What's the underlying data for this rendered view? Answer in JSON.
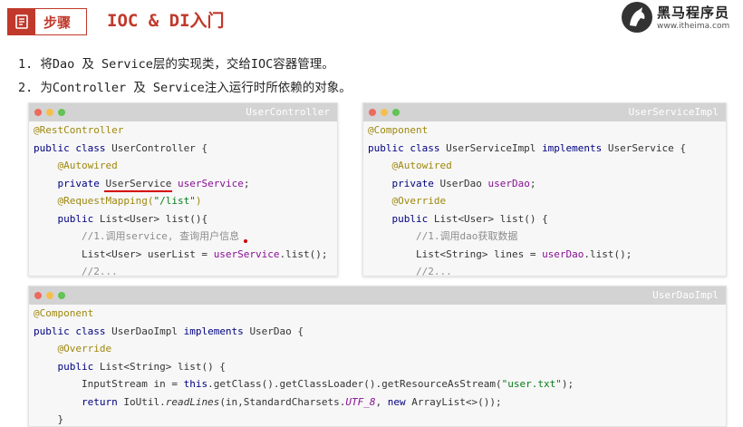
{
  "header": {
    "badge_label": "步骤",
    "title": "IOC & DI入门"
  },
  "logo": {
    "name": "黑马程序员",
    "url": "www.itheima.com"
  },
  "steps": [
    "1. 将Dao 及 Service层的实现类，交给IOC容器管理。",
    "2. 为Controller 及 Service注入运行时所依赖的对象。"
  ],
  "windows": {
    "user_controller": {
      "title": "UserController",
      "l1": "@RestController",
      "l2_kw": "public class ",
      "l2_rest": "UserController {",
      "l3": "@Autowired",
      "l4_kw": "private ",
      "l4_type": "UserService",
      "l4_field": "userService",
      "l4_end": ";",
      "l5_ann": "@RequestMapping(",
      "l5_str": "\"/list\"",
      "l5_end": ")",
      "l6_kw": "public ",
      "l6_rest": "List<User> list(){",
      "l7": "//1.调用service, 查询用户信息",
      "l8_a": "List<User> userList = ",
      "l8_field": "userService",
      "l8_end": ".list();",
      "l9": "//2..."
    },
    "user_service_impl": {
      "title": "UserServiceImpl",
      "l1": "@Component",
      "l2_kw": "public class ",
      "l2_name": "UserServiceImpl ",
      "l2_kw2": "implements ",
      "l2_rest": "UserService {",
      "l3": "@Autowired",
      "l4_kw": "private ",
      "l4_type": "UserDao ",
      "l4_field": "userDao",
      "l4_end": ";",
      "l5": "@Override",
      "l6_kw": "public ",
      "l6_rest": "List<User> list() {",
      "l7": "//1.调用dao获取数据",
      "l8_a": "List<String> lines = ",
      "l8_field": "userDao",
      "l8_end": ".list();",
      "l9": "//2..."
    },
    "user_dao_impl": {
      "title": "UserDaoImpl",
      "l1": "@Component",
      "l2_kw": "public class ",
      "l2_name": "UserDaoImpl ",
      "l2_kw2": "implements ",
      "l2_rest": "UserDao {",
      "l3": "@Override",
      "l4_kw": "public ",
      "l4_rest": "List<String> list() {",
      "l5_a": "InputStream in = ",
      "l5_kw": "this",
      "l5_b": ".getClass().getClassLoader().getResourceAsStream(",
      "l5_str": "\"user.txt\"",
      "l5_end": ");",
      "l6_kw": "return ",
      "l6_a": "IoUtil.",
      "l6_it": "readLines",
      "l6_b": "(in,StandardCharsets.",
      "l6_fld": "UTF_8",
      "l6_c": ", ",
      "l6_kw2": "new ",
      "l6_d": "ArrayList<>());",
      "l7": "}"
    }
  }
}
